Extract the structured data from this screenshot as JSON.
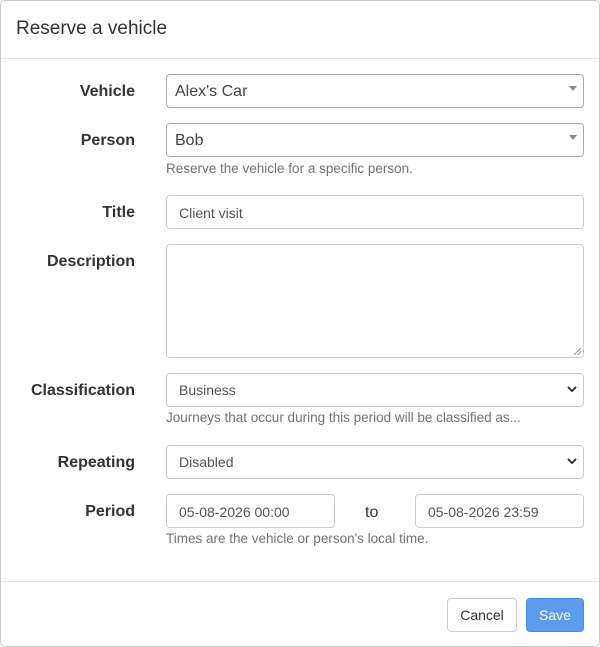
{
  "modal": {
    "title": "Reserve a vehicle"
  },
  "form": {
    "vehicle": {
      "label": "Vehicle",
      "value": "Alex's Car"
    },
    "person": {
      "label": "Person",
      "value": "Bob",
      "help": "Reserve the vehicle for a specific person."
    },
    "title": {
      "label": "Title",
      "value": "Client visit"
    },
    "description": {
      "label": "Description",
      "value": ""
    },
    "classification": {
      "label": "Classification",
      "value": "Business",
      "help": "Journeys that occur during this period will be classified as..."
    },
    "repeating": {
      "label": "Repeating",
      "value": "Disabled"
    },
    "period": {
      "label": "Period",
      "from": "05-08-2026 00:00",
      "to_text": "to",
      "to": "05-08-2026 23:59",
      "help": "Times are the vehicle or person's local time."
    }
  },
  "footer": {
    "cancel_label": "Cancel",
    "save_label": "Save",
    "save_color": "#5b9cef"
  },
  "icons": {
    "select_arrow": "caret-down-icon",
    "select_chevron": "chevron-down-icon",
    "textarea_resize": "resize-grip-icon"
  }
}
